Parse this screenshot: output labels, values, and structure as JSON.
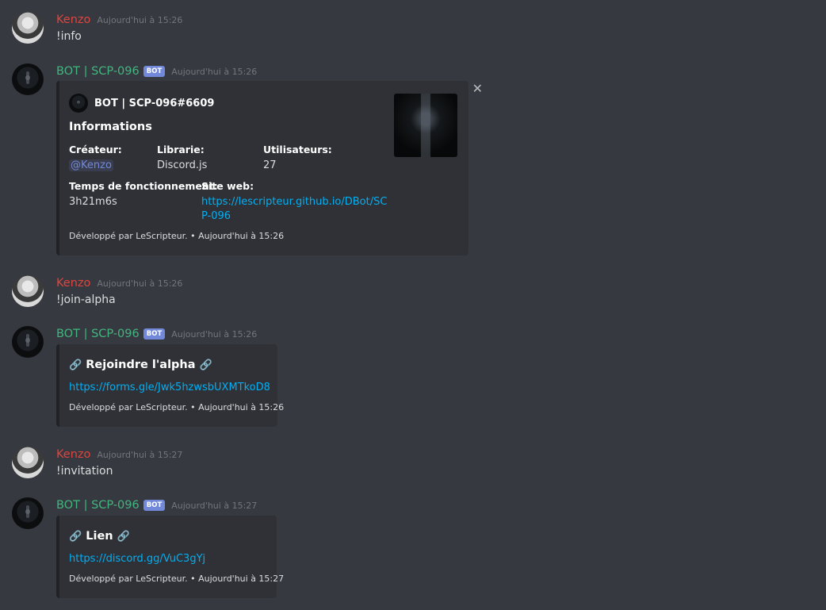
{
  "messages": [
    {
      "author": "Kenzo",
      "timestamp": "Aujourd'hui à 15:26",
      "text": "!info"
    },
    {
      "author": "BOT | SCP-096",
      "bot_tag": "BOT",
      "timestamp": "Aujourd'hui à 15:26",
      "embed": {
        "author_name": "BOT | SCP-096#6609",
        "title": "Informations",
        "fields": [
          {
            "name": "Créateur:",
            "value": "@Kenzo"
          },
          {
            "name": "Librarie:",
            "value": "Discord.js"
          },
          {
            "name": "Utilisateurs:",
            "value": "27"
          },
          {
            "name": "Temps de fonctionnement:",
            "value": "3h21m6s"
          },
          {
            "name": "Site web:",
            "value_line1": "https://lescripteur.github.io/DBot/SC",
            "value_line2": "P-096"
          }
        ],
        "footer": "Développé par LeScripteur. • Aujourd'hui à 15:26",
        "close_label": "✕"
      }
    },
    {
      "author": "Kenzo",
      "timestamp": "Aujourd'hui à 15:26",
      "text": "!join-alpha"
    },
    {
      "author": "BOT | SCP-096",
      "bot_tag": "BOT",
      "timestamp": "Aujourd'hui à 15:26",
      "embed": {
        "title": "Rejoindre l'alpha",
        "link": "https://forms.gle/Jwk5hzwsbUXMTkoD8",
        "footer": "Développé par LeScripteur. • Aujourd'hui à 15:26"
      }
    },
    {
      "author": "Kenzo",
      "timestamp": "Aujourd'hui à 15:27",
      "text": "!invitation"
    },
    {
      "author": "BOT | SCP-096",
      "bot_tag": "BOT",
      "timestamp": "Aujourd'hui à 15:27",
      "embed": {
        "title": "Lien",
        "link": "https://discord.gg/VuC3gYj",
        "footer": "Développé par LeScripteur. • Aujourd'hui à 15:27"
      }
    }
  ],
  "icons": {
    "chain": "🔗"
  },
  "colors": {
    "background": "#36393f",
    "embed_bg": "#2f3136",
    "user_name": "#e0443e",
    "bot_name": "#43b581",
    "bot_tag": "#7289da",
    "link": "#00b0f4"
  }
}
